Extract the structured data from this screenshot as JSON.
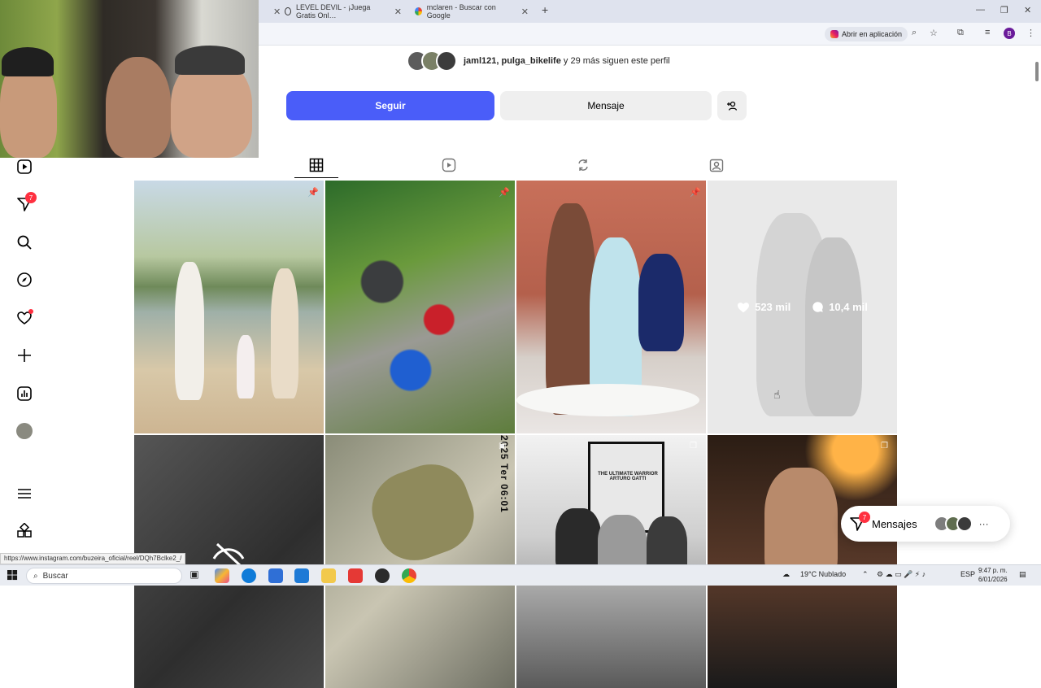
{
  "browser": {
    "tabs": [
      {
        "label": "LEVEL DEVIL - ¡Juega Gratis Onl…"
      },
      {
        "label": "mclaren - Buscar con Google"
      }
    ],
    "open_in_app": "Abrir en aplicación",
    "profile_initial": "B",
    "status_url": "https://www.instagram.com/buzeira_oficial/reel/DQh7Bclke2_/"
  },
  "sidebar": {
    "notifications_badge": "7"
  },
  "profile": {
    "followed_by_users": "jaml121, pulga_bikelife",
    "followed_by_rest": " y 29 más siguen este perfil",
    "follow_button": "Seguir",
    "message_button": "Mensaje",
    "add_person_icon": "+𐀪"
  },
  "tabs": [
    "grid",
    "reels",
    "reposts",
    "tagged"
  ],
  "hover_post": {
    "likes": "523 mil",
    "comments": "10,4 mil"
  },
  "posts": {
    "overlay_text_vertical": "2025 Ter 06:01",
    "poster_title": "THE ULTIMATE WARRIOR ARTURO GATTI"
  },
  "chat_widget": {
    "label": "Mensajes",
    "badge": "7"
  },
  "taskbar": {
    "search_placeholder": "Buscar",
    "weather": "19°C  Nublado",
    "language": "ESP",
    "time": "9:47 p. m.",
    "date": "6/01/2026"
  }
}
